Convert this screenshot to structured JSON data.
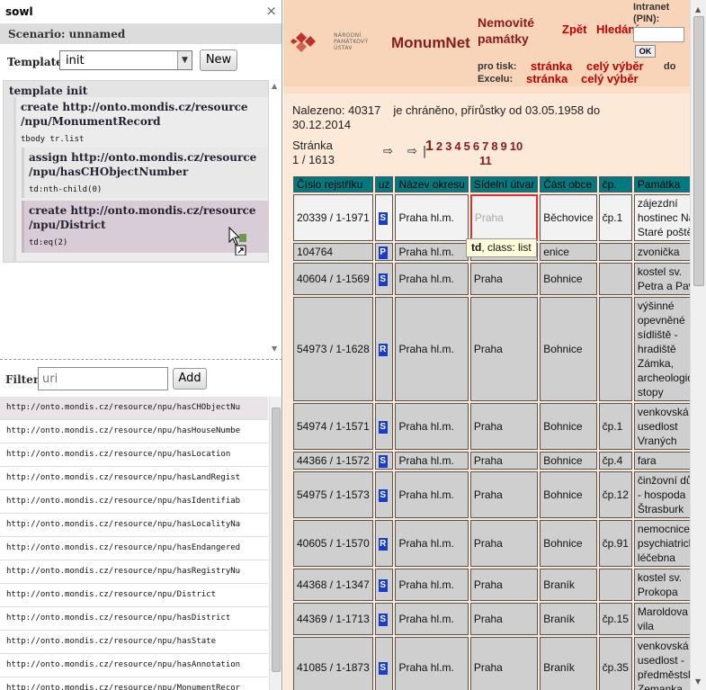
{
  "panel": {
    "title": "sowl",
    "close": "×",
    "scenario": "Scenario: unnamed",
    "template_label": "Template:",
    "template_value": "init",
    "new_label": "New",
    "tree": {
      "root": "template init",
      "node1": {
        "line1": "create http://onto.mondis.cz/resource",
        "line2": "/npu/MonumentRecord",
        "selector": "tbody tr.list"
      },
      "node2": {
        "line1": "assign http://onto.mondis.cz/resource",
        "line2": "/npu/hasCHObjectNumber",
        "selector": "td:nth-child(0)"
      },
      "node3": {
        "line1": "create http://onto.mondis.cz/resource",
        "line2": "/npu/District",
        "selector": "td:eq(2)"
      }
    },
    "filter_label": "Filter:",
    "filter_placeholder": "uri",
    "add_label": "Add",
    "uris": [
      "http://onto.mondis.cz/resource/npu/hasCHObjectNu",
      "http://onto.mondis.cz/resource/npu/hasHouseNumbe",
      "http://onto.mondis.cz/resource/npu/hasLocation",
      "http://onto.mondis.cz/resource/npu/hasLandRegist",
      "http://onto.mondis.cz/resource/npu/hasIdentifiab",
      "http://onto.mondis.cz/resource/npu/hasLocalityNa",
      "http://onto.mondis.cz/resource/npu/hasEndangered",
      "http://onto.mondis.cz/resource/npu/hasRegistryNu",
      "http://onto.mondis.cz/resource/npu/District",
      "http://onto.mondis.cz/resource/npu/hasDistrict",
      "http://onto.mondis.cz/resource/npu/hasState",
      "http://onto.mondis.cz/resource/npu/hasAnnotation",
      "http://onto.mondis.cz/resource/npu/MonumentRecor"
    ]
  },
  "site": {
    "logo_text": [
      "NÁRODNÍ",
      "PAMÁTKOVÝ",
      "ÚSTAV"
    ],
    "brand": "MonumNet",
    "nemo": "Nemovité památky",
    "zpet": "Zpět",
    "hledani": "Hledání",
    "intranet": "Intranet (PIN):",
    "ok": "OK",
    "protisk": "pro tisk:",
    "excelu": "Excelu:",
    "stranka1": "stránka",
    "cely1": "celý výběr",
    "do": "do",
    "stranka2": "stránka",
    "cely2": "celý výběr",
    "nalezeno": "Nalezeno: 40317",
    "chraneno": "je chráněno, přírůstky od 03.05.1958 do 30.12.2014",
    "stranka_label": "Stránka",
    "stranka_value": "1 / 1613",
    "nav_arrows": "⇨ ⇨|",
    "pages": [
      "1",
      "2",
      "3",
      "4",
      "5",
      "6",
      "7",
      "8",
      "9",
      "10"
    ],
    "page11": "11",
    "headers": [
      "Číslo rejstříku",
      "uz",
      "Název okresu",
      "Sídelní útvar",
      "Část obce",
      "čp.",
      "Památka"
    ],
    "rows": [
      {
        "cislo": "20339 / 1-1971",
        "uz": "S",
        "okres": "Praha hl.m.",
        "utvar": "Praha",
        "cast": "Běchovice",
        "cp": "čp.1",
        "pamatka": "zájezdní hostinec Na Staré poště"
      },
      {
        "cislo": "104764",
        "uz": "P",
        "okres": "Praha hl.m.",
        "utvar": "",
        "cast": "enice",
        "cp": "",
        "pamatka": "zvonička"
      },
      {
        "cislo": "40604 / 1-1569",
        "uz": "S",
        "okres": "Praha hl.m.",
        "utvar": "Praha",
        "cast": "Bohnice",
        "cp": "",
        "pamatka": "kostel sv. Petra a Pavla"
      },
      {
        "cislo": "54973 / 1-1628",
        "uz": "R",
        "okres": "Praha hl.m.",
        "utvar": "Praha",
        "cast": "Bohnice",
        "cp": "",
        "pamatka": "výšinné opevněné sídliště - hradiště Zámka, archeologické stopy"
      },
      {
        "cislo": "54974 / 1-1571",
        "uz": "S",
        "okres": "Praha hl.m.",
        "utvar": "Praha",
        "cast": "Bohnice",
        "cp": "čp.1",
        "pamatka": "venkovská usedlost Vraných"
      },
      {
        "cislo": "44366 / 1-1572",
        "uz": "S",
        "okres": "Praha hl.m.",
        "utvar": "Praha",
        "cast": "Bohnice",
        "cp": "čp.4",
        "pamatka": "fara"
      },
      {
        "cislo": "54975 / 1-1573",
        "uz": "S",
        "okres": "Praha hl.m.",
        "utvar": "Praha",
        "cast": "Bohnice",
        "cp": "čp.12",
        "pamatka": "činžovní dům - hospoda Štrasburk"
      },
      {
        "cislo": "40605 / 1-1570",
        "uz": "R",
        "okres": "Praha hl.m.",
        "utvar": "Praha",
        "cast": "Bohnice",
        "cp": "čp.91",
        "pamatka": "nemocnice psychiatrická léčebna"
      },
      {
        "cislo": "44368 / 1-1347",
        "uz": "S",
        "okres": "Praha hl.m.",
        "utvar": "Praha",
        "cast": "Braník",
        "cp": "",
        "pamatka": "kostel sv. Prokopa"
      },
      {
        "cislo": "44369 / 1-1713",
        "uz": "S",
        "okres": "Praha hl.m.",
        "utvar": "Praha",
        "cast": "Braník",
        "cp": "čp.15",
        "pamatka": "Maroldova vila"
      },
      {
        "cislo": "41085 / 1-1873",
        "uz": "S",
        "okres": "Praha hl.m.",
        "utvar": "Praha",
        "cast": "Braník",
        "cp": "čp.35",
        "pamatka": "venkovská usedlost - předměstská Zemanka"
      }
    ],
    "tooltip_tag": "td",
    "tooltip_rest": ", class: list"
  },
  "colors": {
    "header_bg": "#f8d5b8",
    "body_bg": "#fde9d8",
    "brand_red": "#8b1a1a",
    "link_red": "#c00000",
    "th_bg": "#007a80",
    "badge_blue": "#1a3ccc",
    "tree_highlight": "#d8ccd6"
  }
}
